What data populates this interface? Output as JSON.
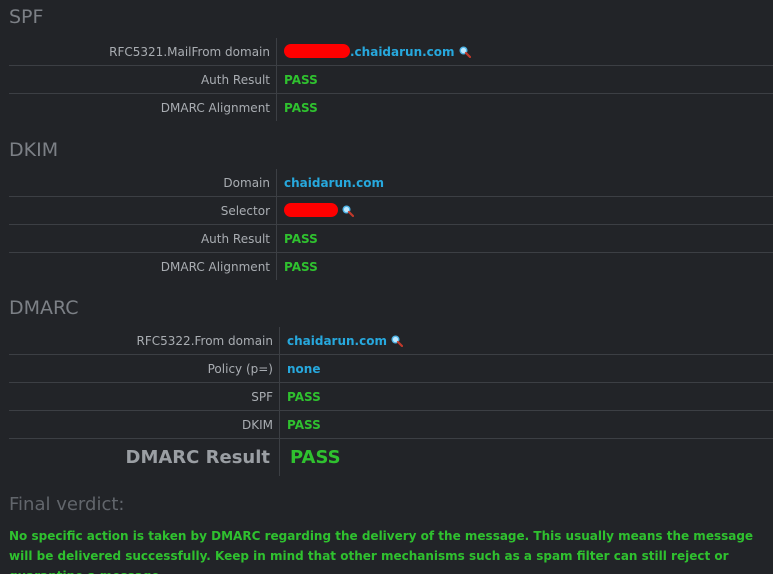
{
  "spf": {
    "title": "SPF",
    "mailfrom_label": "RFC5321.MailFrom domain",
    "mailfrom_value": ".chaidarun.com",
    "auth_label": "Auth Result",
    "auth_value": "PASS",
    "alignment_label": "DMARC Alignment",
    "alignment_value": "PASS"
  },
  "dkim": {
    "title": "DKIM",
    "domain_label": "Domain",
    "domain_value": "chaidarun.com",
    "selector_label": "Selector",
    "auth_label": "Auth Result",
    "auth_value": "PASS",
    "alignment_label": "DMARC Alignment",
    "alignment_value": "PASS"
  },
  "dmarc": {
    "title": "DMARC",
    "from_label": "RFC5322.From domain",
    "from_value": "chaidarun.com",
    "policy_label": "Policy (p=)",
    "policy_value": "none",
    "spf_label": "SPF",
    "spf_value": "PASS",
    "dkim_label": "DKIM",
    "dkim_value": "PASS",
    "result_label": "DMARC Result",
    "result_value": "PASS"
  },
  "verdict": {
    "title": "Final verdict:",
    "text": "No specific action is taken by DMARC regarding the delivery of the message. This usually means the message will be delivered successfully. Keep in mind that other mechanisms such as a spam filter can still reject or quarantine a message."
  },
  "colors": {
    "background": "#222428",
    "pass": "#2fc12f",
    "link": "#27a8dd",
    "redaction": "#ff0000"
  },
  "icons": [
    "magnifier-icon"
  ]
}
